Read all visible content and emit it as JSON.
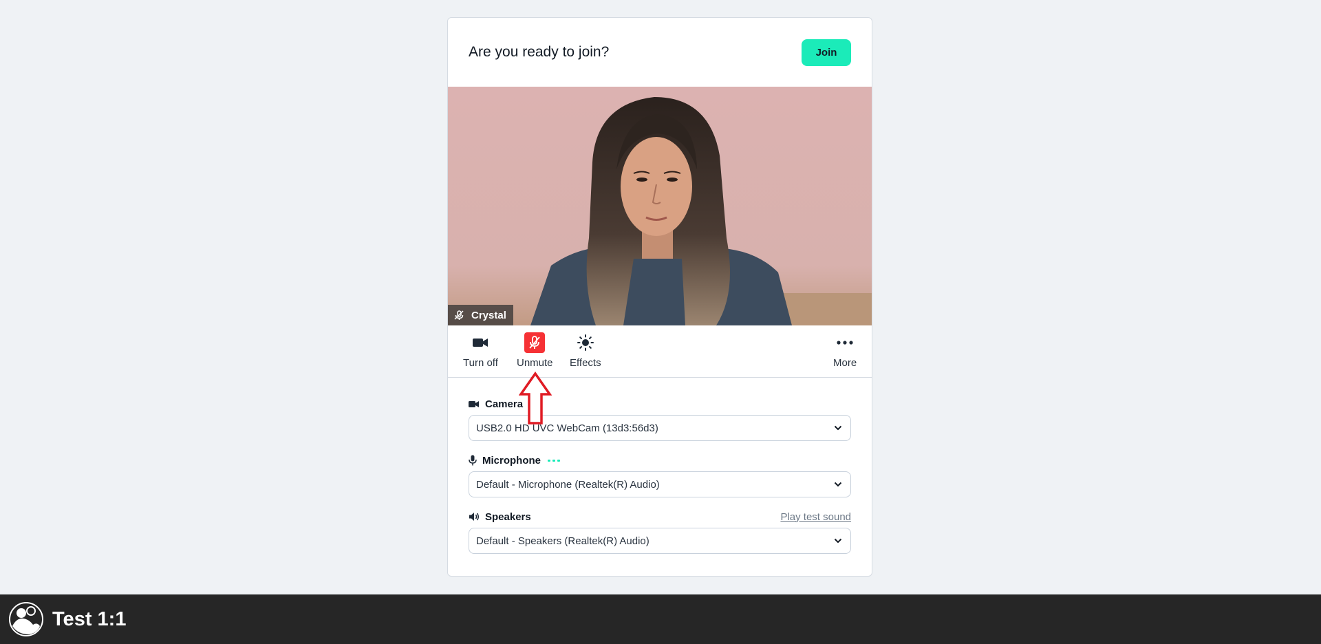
{
  "prejoin": {
    "title": "Are you ready to join?",
    "join_label": "Join"
  },
  "video": {
    "participant_name": "Crystal"
  },
  "controls": {
    "camera_label": "Turn off",
    "mic_label": "Unmute",
    "effects_label": "Effects",
    "more_label": "More"
  },
  "settings": {
    "camera": {
      "label": "Camera",
      "value": "USB2.0 HD UVC WebCam (13d3:56d3)"
    },
    "microphone": {
      "label": "Microphone",
      "value": "Default - Microphone (Realtek(R) Audio)"
    },
    "speakers": {
      "label": "Speakers",
      "value": "Default - Speakers (Realtek(R) Audio)",
      "test_link": "Play test sound"
    }
  },
  "footer": {
    "room_title": "Test 1:1"
  },
  "colors": {
    "accent": "#1bebb9",
    "muted_red": "#f63135",
    "annotation_red": "#e01b24",
    "bottom_bar": "#262626",
    "page_bg": "#eff2f5"
  },
  "icons": {
    "camera": "video-camera-icon",
    "mic_muted": "microphone-off-icon",
    "effects": "sun-icon",
    "more": "ellipsis-icon",
    "microphone": "microphone-icon",
    "speaker": "speaker-icon",
    "chevron": "chevron-down-icon",
    "logo": "daily-logo-icon"
  }
}
